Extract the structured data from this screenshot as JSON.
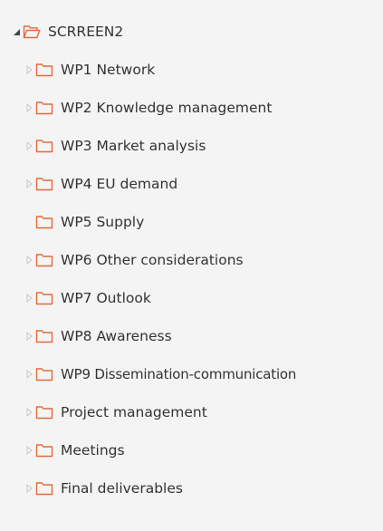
{
  "tree": {
    "root": {
      "label": "SCRREEN2",
      "expanded": true,
      "icon": "folder-open-icon"
    },
    "items": [
      {
        "label": "WP1 Network",
        "has_children": true,
        "icon": "folder-icon"
      },
      {
        "label": "WP2 Knowledge management",
        "has_children": true,
        "icon": "folder-icon"
      },
      {
        "label": "WP3 Market analysis",
        "has_children": true,
        "icon": "folder-icon"
      },
      {
        "label": "WP4 EU demand",
        "has_children": true,
        "icon": "folder-icon"
      },
      {
        "label": "WP5 Supply",
        "has_children": false,
        "icon": "folder-icon"
      },
      {
        "label": "WP6 Other considerations",
        "has_children": true,
        "icon": "folder-icon"
      },
      {
        "label": "WP7 Outlook",
        "has_children": true,
        "icon": "folder-icon"
      },
      {
        "label": "WP8 Awareness",
        "has_children": true,
        "icon": "folder-icon"
      },
      {
        "label": "WP9 Dissemination-communication",
        "has_children": true,
        "icon": "folder-icon"
      },
      {
        "label": "Project management",
        "has_children": true,
        "icon": "folder-icon"
      },
      {
        "label": "Meetings",
        "has_children": true,
        "icon": "folder-icon"
      },
      {
        "label": "Final deliverables",
        "has_children": true,
        "icon": "folder-icon"
      }
    ]
  },
  "colors": {
    "folder_stroke": "#e06b3a",
    "toggle_collapsed": "#c8c8c8",
    "toggle_expanded": "#444444",
    "text": "#333333",
    "background": "#f4f4f4"
  }
}
